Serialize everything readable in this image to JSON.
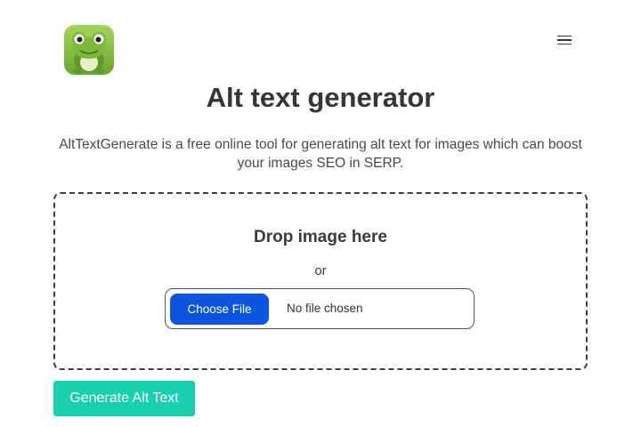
{
  "header": {
    "logo_icon": "frog-logo-icon",
    "menu_icon": "hamburger-menu-icon"
  },
  "main": {
    "title": "Alt text generator",
    "description": "AltTextGenerate is a free online tool for generating alt text for images which can boost your images SEO in SERP."
  },
  "dropzone": {
    "title": "Drop image here",
    "or_text": "or",
    "choose_file_label": "Choose File",
    "file_status": "No file chosen"
  },
  "actions": {
    "generate_label": "Generate Alt Text"
  },
  "colors": {
    "choose_button": "#0b55e0",
    "generate_button": "#19cfae",
    "logo_background": "#8bc34a"
  }
}
